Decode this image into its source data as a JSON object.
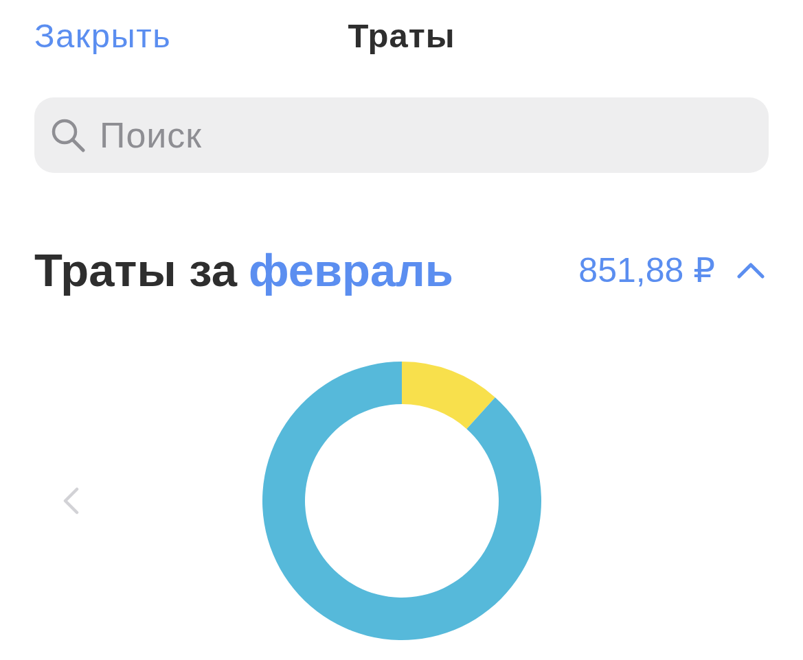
{
  "nav": {
    "close": "Закрыть",
    "title": "Траты"
  },
  "search": {
    "placeholder": "Поиск"
  },
  "summary": {
    "heading": "Траты за",
    "month": "февраль",
    "total": "851,88 ₽",
    "expanded": true
  }
}
